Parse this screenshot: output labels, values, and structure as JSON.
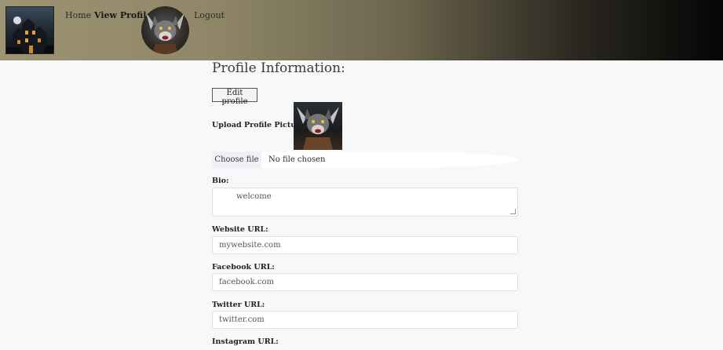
{
  "nav": {
    "home": "Home",
    "view_profile": "View Profile",
    "logout": "Logout"
  },
  "page": {
    "title": "Profile Information:",
    "edit_button": "Edit profile"
  },
  "upload": {
    "label": "Upload Profile Picture:",
    "choose_file": "Choose file",
    "status": "No file chosen"
  },
  "bio": {
    "label": "Bio:",
    "value": "welcome"
  },
  "website": {
    "label": "Website URL:",
    "value": "mywebsite.com"
  },
  "facebook": {
    "label": "Facebook URL:",
    "value": "facebook.com"
  },
  "twitter": {
    "label": "Twitter URL:",
    "value": "twitter.com"
  },
  "instagram": {
    "label": "Instagram URL:"
  },
  "icons": {
    "logo": "haunted-house-logo",
    "avatar": "werewolf-avatar"
  }
}
